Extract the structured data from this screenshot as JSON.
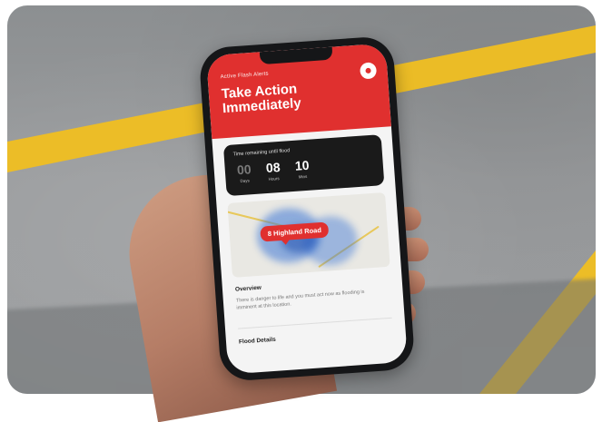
{
  "app": {
    "subtitle": "Active Flash Alerts",
    "title": "Take Action Immediately",
    "share_icon": "share-icon",
    "accent_color": "#e0302f"
  },
  "timer": {
    "label": "Time remaining until flood",
    "units": [
      {
        "value": "00",
        "label": "Days"
      },
      {
        "value": "08",
        "label": "Hours"
      },
      {
        "value": "10",
        "label": "Mins"
      }
    ]
  },
  "map": {
    "pin_label": "8 Highland Road"
  },
  "overview": {
    "heading": "Overview",
    "body": "There is danger to life and you must act now as flooding is imminent at this location."
  },
  "flood_details": {
    "heading": "Flood Details"
  }
}
